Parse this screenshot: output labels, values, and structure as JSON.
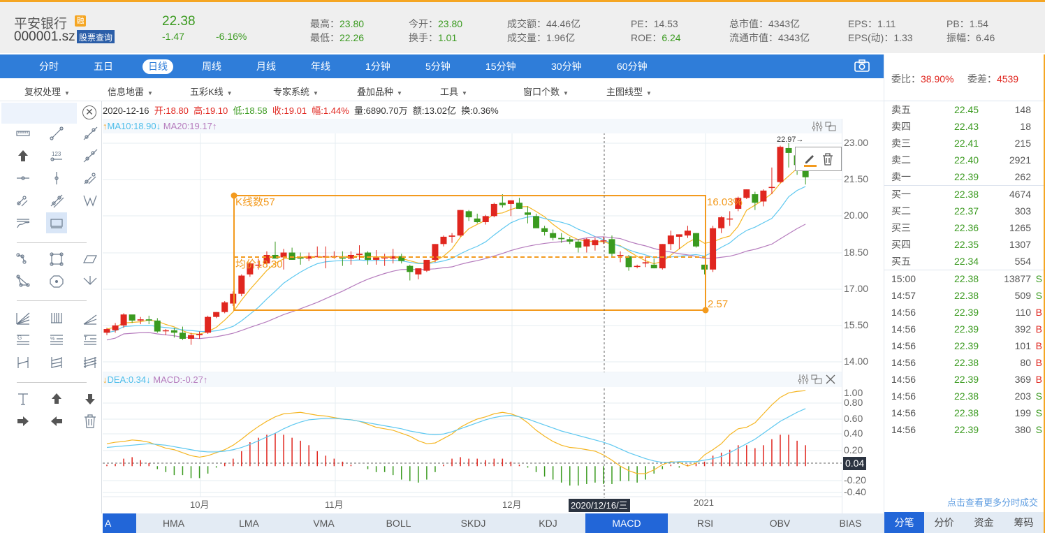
{
  "header": {
    "stock_name": "平安银行",
    "margin_badge": "融",
    "stock_code": "000001.sz",
    "query_button": "股票查询",
    "price": "22.38",
    "change": "-1.47",
    "change_pct": "-6.16%",
    "stats": [
      {
        "label": "最高：",
        "value": "23.80",
        "color": "green"
      },
      {
        "label": "最低：",
        "value": "22.26",
        "color": "green"
      },
      {
        "label": "今开：",
        "value": "23.80",
        "color": "green"
      },
      {
        "label": "换手：",
        "value": "1.01",
        "color": "green"
      },
      {
        "label": "成交额：",
        "value": "44.46亿",
        "color": "plain"
      },
      {
        "label": "成交量：",
        "value": "1.96亿",
        "color": "plain"
      },
      {
        "label": "PE：",
        "value": "14.53",
        "color": "plain"
      },
      {
        "label": "ROE：",
        "value": "6.24",
        "color": "green"
      },
      {
        "label": "总市值：",
        "value": "4343亿",
        "color": "plain"
      },
      {
        "label": "流通市值：",
        "value": "4343亿",
        "color": "plain"
      },
      {
        "label": "EPS：",
        "value": "1.11",
        "color": "plain"
      },
      {
        "label": "EPS(动)：",
        "value": "1.33",
        "color": "plain"
      },
      {
        "label": "PB：",
        "value": "1.54",
        "color": "plain"
      },
      {
        "label": "振幅：",
        "value": "6.46",
        "color": "plain"
      }
    ]
  },
  "periods": [
    "分时",
    "五日",
    "日线",
    "周线",
    "月线",
    "年线",
    "1分钟",
    "5分钟",
    "15分钟",
    "30分钟",
    "60分钟"
  ],
  "active_period": "日线",
  "toolbar2": [
    "复权处理",
    "信息地雷",
    "五彩K线",
    "专家系统",
    "叠加品种",
    "工具",
    "窗口个数",
    "主图线型"
  ],
  "info_line": {
    "date": "2020-12-16",
    "open": "开:18.80",
    "high": "高:19.10",
    "low": "低:18.58",
    "close": "收:19.01",
    "amp": "幅:1.44%",
    "volume": "量:6890.70万",
    "amount": "额:13.02亿",
    "turnover": "换:0.36%"
  },
  "ma_legend": {
    "ma10": "MA10:18.90",
    "ma20": "MA20:19.17",
    "up_arrow": "↑",
    "down_arrow": "↓"
  },
  "macd_legend": {
    "dea": "DEA:0.34",
    "macd": "MACD:-0.27",
    "up_arrow": "↑",
    "down_arrow": "↓"
  },
  "annotation": {
    "kline_count": "K线数57",
    "avg_price": "均价18.30",
    "pct": "16.03%",
    "diff": "2.57",
    "last_high": "22.97→"
  },
  "price_axis": [
    "23.00",
    "21.50",
    "20.00",
    "18.50",
    "17.00",
    "15.50",
    "14.00"
  ],
  "macd_axis": [
    "1.00",
    "0.80",
    "0.60",
    "0.40",
    "0.20",
    "0.04",
    "-0.20",
    "-0.40"
  ],
  "x_axis": [
    "10月",
    "11月",
    "12月",
    "2021"
  ],
  "crosshair_date": "2020/12/16/三",
  "indicator_tabs": [
    "A",
    "HMA",
    "LMA",
    "VMA",
    "BOLL",
    "SKDJ",
    "KDJ",
    "MACD",
    "RSI",
    "OBV",
    "BIAS"
  ],
  "active_indicator": "MACD",
  "order_book": {
    "ratio_label": "委比：",
    "ratio_value": "38.90%",
    "diff_label": "委差：",
    "diff_value": "4539",
    "asks": [
      {
        "label": "卖五",
        "price": "22.45",
        "vol": "148"
      },
      {
        "label": "卖四",
        "price": "22.43",
        "vol": "18"
      },
      {
        "label": "卖三",
        "price": "22.41",
        "vol": "215"
      },
      {
        "label": "卖二",
        "price": "22.40",
        "vol": "2921"
      },
      {
        "label": "卖一",
        "price": "22.39",
        "vol": "262"
      }
    ],
    "bids": [
      {
        "label": "买一",
        "price": "22.38",
        "vol": "4674"
      },
      {
        "label": "买二",
        "price": "22.37",
        "vol": "303"
      },
      {
        "label": "买三",
        "price": "22.36",
        "vol": "1265"
      },
      {
        "label": "买四",
        "price": "22.35",
        "vol": "1307"
      },
      {
        "label": "买五",
        "price": "22.34",
        "vol": "554"
      }
    ]
  },
  "trades": [
    {
      "time": "15:00",
      "price": "22.38",
      "vol": "13877",
      "side": "S"
    },
    {
      "time": "14:57",
      "price": "22.38",
      "vol": "509",
      "side": "S"
    },
    {
      "time": "14:56",
      "price": "22.39",
      "vol": "110",
      "side": "B"
    },
    {
      "time": "14:56",
      "price": "22.39",
      "vol": "392",
      "side": "B"
    },
    {
      "time": "14:56",
      "price": "22.39",
      "vol": "101",
      "side": "B"
    },
    {
      "time": "14:56",
      "price": "22.38",
      "vol": "80",
      "side": "B"
    },
    {
      "time": "14:56",
      "price": "22.39",
      "vol": "369",
      "side": "B"
    },
    {
      "time": "14:56",
      "price": "22.38",
      "vol": "203",
      "side": "S"
    },
    {
      "time": "14:56",
      "price": "22.38",
      "vol": "199",
      "side": "S"
    },
    {
      "time": "14:56",
      "price": "22.39",
      "vol": "380",
      "side": "S"
    }
  ],
  "more_trades_link": "点击查看更多分时成交",
  "right_tabs": [
    "分笔",
    "分价",
    "资金",
    "筹码"
  ],
  "active_right_tab": "分笔",
  "colors": {
    "up": "#e0261f",
    "down": "#3a9a1f",
    "ma5": "#f5b623",
    "ma10": "#5ec8f0",
    "ma20": "#b57bbd",
    "accent": "#2f7dd9",
    "annotation": "#f39a1e"
  },
  "chart_data": {
    "type": "candlestick",
    "price_range": [
      14.0,
      23.5
    ],
    "candles": [
      [
        15.2,
        15.4,
        15.1,
        15.35
      ],
      [
        15.3,
        15.6,
        15.2,
        15.5
      ],
      [
        15.5,
        16.0,
        15.4,
        15.95
      ],
      [
        15.95,
        15.9,
        15.6,
        15.7
      ],
      [
        15.7,
        15.85,
        15.55,
        15.75
      ],
      [
        15.75,
        15.9,
        15.55,
        15.7
      ],
      [
        15.7,
        15.8,
        15.2,
        15.25
      ],
      [
        15.3,
        15.35,
        15.1,
        15.3
      ],
      [
        15.3,
        15.4,
        15.0,
        15.2
      ],
      [
        15.2,
        15.45,
        14.9,
        14.95
      ],
      [
        14.95,
        15.2,
        14.7,
        15.1
      ],
      [
        15.1,
        15.25,
        14.95,
        15.15
      ],
      [
        15.2,
        15.9,
        15.15,
        15.85
      ],
      [
        15.85,
        16.05,
        15.8,
        16.05
      ],
      [
        16.05,
        16.5,
        16.0,
        16.45
      ],
      [
        16.4,
        16.9,
        16.3,
        16.8
      ],
      [
        16.8,
        17.6,
        16.7,
        17.55
      ],
      [
        17.6,
        18.1,
        17.5,
        18.05
      ],
      [
        18.0,
        18.25,
        17.8,
        18.0
      ],
      [
        18.05,
        18.55,
        17.9,
        18.4
      ],
      [
        18.4,
        18.95,
        18.3,
        18.25
      ],
      [
        18.3,
        18.65,
        17.8,
        18.5
      ],
      [
        18.5,
        18.7,
        18.2,
        18.2
      ],
      [
        18.3,
        18.5,
        18.0,
        18.25
      ],
      [
        18.25,
        18.5,
        18.15,
        18.35
      ],
      [
        18.35,
        18.75,
        18.3,
        18.35
      ],
      [
        18.35,
        18.75,
        17.85,
        18.35
      ],
      [
        18.35,
        18.55,
        18.25,
        18.35
      ],
      [
        18.3,
        18.55,
        17.95,
        18.25
      ],
      [
        18.25,
        18.55,
        18.0,
        18.4
      ],
      [
        18.4,
        18.8,
        18.2,
        18.45
      ],
      [
        18.5,
        18.55,
        18.0,
        18.2
      ],
      [
        18.2,
        18.6,
        18.0,
        18.3
      ],
      [
        18.3,
        18.45,
        17.95,
        18.3
      ],
      [
        18.25,
        18.65,
        18.05,
        18.35
      ],
      [
        18.35,
        18.45,
        18.05,
        18.15
      ],
      [
        17.95,
        18.0,
        17.35,
        17.7
      ],
      [
        17.6,
        17.75,
        17.4,
        17.85
      ],
      [
        17.75,
        18.1,
        17.7,
        18.2
      ],
      [
        18.2,
        18.85,
        18.1,
        18.85
      ],
      [
        18.85,
        19.2,
        18.75,
        19.15
      ],
      [
        19.15,
        19.3,
        18.9,
        19.2
      ],
      [
        19.2,
        20.25,
        19.15,
        20.25
      ],
      [
        20.2,
        20.25,
        19.8,
        19.95
      ],
      [
        19.9,
        20.1,
        19.7,
        19.75
      ],
      [
        19.75,
        20.05,
        19.65,
        20.0
      ],
      [
        20.0,
        20.55,
        19.95,
        20.5
      ],
      [
        20.55,
        20.9,
        20.35,
        20.45
      ],
      [
        20.5,
        20.65,
        20.0,
        20.65
      ],
      [
        20.55,
        20.75,
        20.3,
        20.3
      ],
      [
        20.15,
        20.4,
        19.7,
        20.05
      ],
      [
        20.0,
        20.1,
        19.7,
        19.5
      ],
      [
        19.5,
        19.6,
        19.2,
        19.35
      ],
      [
        19.3,
        19.45,
        19.0,
        19.1
      ],
      [
        19.1,
        19.3,
        18.9,
        19.05
      ],
      [
        19.05,
        19.15,
        18.85,
        18.95
      ],
      [
        18.95,
        19.05,
        18.5,
        18.7
      ],
      [
        18.75,
        19.1,
        18.5,
        19.05
      ],
      [
        18.8,
        19.1,
        18.58,
        19.01
      ],
      [
        19.0,
        19.15,
        18.85,
        19.0
      ],
      [
        19.05,
        19.2,
        18.3,
        18.45
      ],
      [
        18.4,
        18.55,
        18.1,
        18.4
      ],
      [
        18.35,
        18.4,
        17.75,
        17.9
      ],
      [
        17.95,
        18.0,
        17.85,
        17.95
      ],
      [
        18.05,
        18.35,
        17.9,
        18.1
      ],
      [
        18.0,
        18.25,
        17.85,
        17.85
      ],
      [
        17.85,
        18.85,
        17.8,
        18.85
      ],
      [
        18.85,
        19.4,
        18.6,
        19.2
      ],
      [
        19.15,
        19.25,
        18.65,
        19.25
      ],
      [
        19.2,
        19.6,
        19.1,
        19.4
      ],
      [
        19.3,
        19.3,
        18.7,
        18.75
      ],
      [
        18.0,
        18.0,
        17.6,
        17.8
      ],
      [
        17.8,
        19.6,
        17.7,
        19.5
      ],
      [
        19.5,
        20.0,
        19.3,
        19.95
      ],
      [
        19.9,
        20.2,
        19.6,
        19.9
      ],
      [
        20.3,
        20.8,
        20.2,
        20.75
      ],
      [
        20.75,
        21.1,
        20.7,
        21.1
      ],
      [
        20.9,
        21.0,
        20.25,
        20.55
      ],
      [
        20.6,
        21.1,
        20.4,
        21.05
      ],
      [
        21.2,
        22.0,
        20.9,
        21.2
      ],
      [
        21.4,
        22.9,
        21.35,
        22.85
      ],
      [
        22.8,
        23.0,
        22.0,
        22.6
      ],
      [
        22.5,
        22.75,
        21.7,
        22.1
      ],
      [
        22.0,
        22.75,
        21.3,
        21.6
      ]
    ],
    "ma_series": {
      "MA5": "orange",
      "MA10": "cyan",
      "MA20": "purple"
    },
    "macd": {
      "range": [
        -0.45,
        1.05
      ],
      "dif": [
        0.3,
        0.32,
        0.33,
        0.35,
        0.34,
        0.32,
        0.28,
        0.24,
        0.22,
        0.18,
        0.14,
        0.12,
        0.14,
        0.18,
        0.22,
        0.28,
        0.36,
        0.45,
        0.53,
        0.6,
        0.66,
        0.7,
        0.71,
        0.72,
        0.7,
        0.68,
        0.67,
        0.65,
        0.63,
        0.62,
        0.6,
        0.56,
        0.52,
        0.5,
        0.48,
        0.44,
        0.4,
        0.34,
        0.3,
        0.31,
        0.37,
        0.43,
        0.52,
        0.58,
        0.63,
        0.66,
        0.7,
        0.72,
        0.7,
        0.66,
        0.58,
        0.48,
        0.4,
        0.33,
        0.28,
        0.25,
        0.24,
        0.22,
        0.2,
        0.15,
        0.08,
        0.0,
        -0.06,
        -0.1,
        -0.1,
        -0.05,
        0.02,
        0.06,
        0.05,
        0.0,
        0.04,
        0.15,
        0.22,
        0.3,
        0.42,
        0.5,
        0.52,
        0.58,
        0.7,
        0.82,
        0.92,
        0.98,
        1.0,
        1.01
      ],
      "dea": [
        0.25,
        0.26,
        0.27,
        0.28,
        0.29,
        0.3,
        0.29,
        0.28,
        0.26,
        0.24,
        0.22,
        0.2,
        0.19,
        0.19,
        0.2,
        0.22,
        0.25,
        0.29,
        0.34,
        0.39,
        0.44,
        0.5,
        0.55,
        0.59,
        0.62,
        0.63,
        0.64,
        0.64,
        0.63,
        0.62,
        0.6,
        0.58,
        0.56,
        0.54,
        0.52,
        0.5,
        0.47,
        0.45,
        0.43,
        0.42,
        0.43,
        0.46,
        0.5,
        0.54,
        0.58,
        0.62,
        0.65,
        0.67,
        0.68,
        0.66,
        0.63,
        0.59,
        0.55,
        0.51,
        0.47,
        0.44,
        0.41,
        0.38,
        0.35,
        0.32,
        0.28,
        0.23,
        0.18,
        0.14,
        0.1,
        0.07,
        0.05,
        0.05,
        0.06,
        0.06,
        0.06,
        0.08,
        0.1,
        0.13,
        0.18,
        0.24,
        0.3,
        0.36,
        0.44,
        0.52,
        0.6,
        0.66,
        0.72,
        0.77
      ],
      "hist": [
        0.02,
        0.03,
        0.1,
        0.12,
        0.08,
        0.04,
        -0.04,
        -0.08,
        -0.12,
        -0.12,
        -0.16,
        -0.16,
        -0.1,
        -0.02,
        0.04,
        0.1,
        0.2,
        0.32,
        0.38,
        0.42,
        0.44,
        0.42,
        0.38,
        0.34,
        0.28,
        0.2,
        0.14,
        0.1,
        0.06,
        0.02,
        0.0,
        -0.04,
        -0.08,
        -0.08,
        -0.12,
        -0.18,
        -0.2,
        -0.22,
        -0.18,
        -0.08,
        0.02,
        0.1,
        0.12,
        0.1,
        0.1,
        0.08,
        0.1,
        0.1,
        0.06,
        0.02,
        -0.02,
        -0.08,
        -0.14,
        -0.18,
        -0.22,
        -0.26,
        -0.26,
        -0.24,
        -0.22,
        -0.24,
        -0.24,
        -0.2,
        -0.2,
        -0.22,
        -0.18,
        -0.1,
        -0.04,
        0.02,
        -0.02,
        0.02,
        0.04,
        0.06,
        0.14,
        0.18,
        0.22,
        0.28,
        0.28,
        0.24,
        0.28,
        0.36,
        0.42,
        0.42,
        0.34,
        0.28
      ]
    }
  }
}
